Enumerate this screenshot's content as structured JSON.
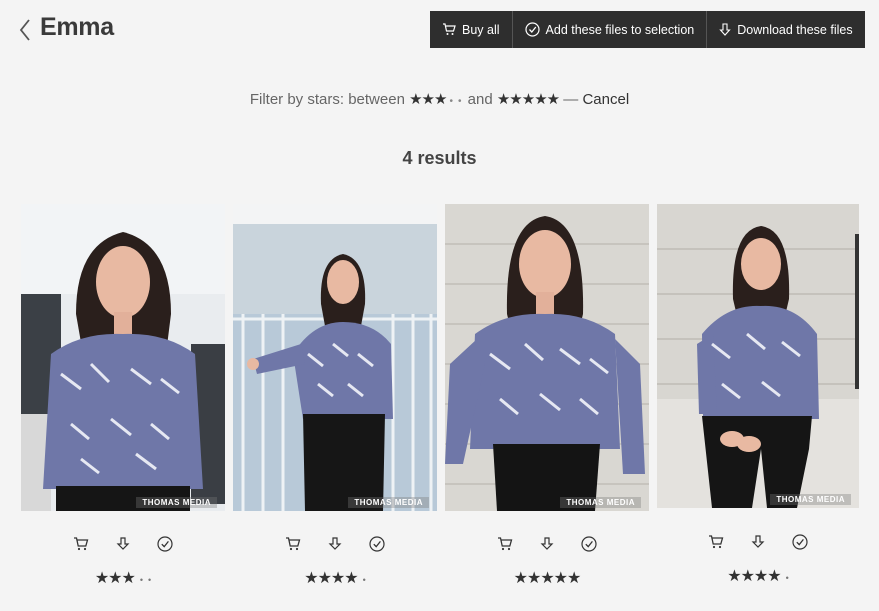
{
  "header": {
    "title": "Emma",
    "buy_all": "Buy all",
    "add_to_selection": "Add these files to selection",
    "download": "Download these files"
  },
  "filter": {
    "prefix": "Filter by stars: between",
    "min_stars": 3,
    "and": "and",
    "max_stars": 5,
    "dash": "—",
    "cancel": "Cancel"
  },
  "results_label": "4 results",
  "photos": [
    {
      "rating": 3,
      "watermark": "THOMAS MEDIA"
    },
    {
      "rating": 4,
      "watermark": "THOMAS MEDIA"
    },
    {
      "rating": 5,
      "watermark": "THOMAS MEDIA"
    },
    {
      "rating": 4,
      "watermark": "THOMAS MEDIA"
    }
  ],
  "colors": {
    "toolbar_bg": "#2e2e2e",
    "page_bg": "#f4f4f4",
    "blouse": "#6f77a8",
    "hair": "#2a1f1c"
  }
}
